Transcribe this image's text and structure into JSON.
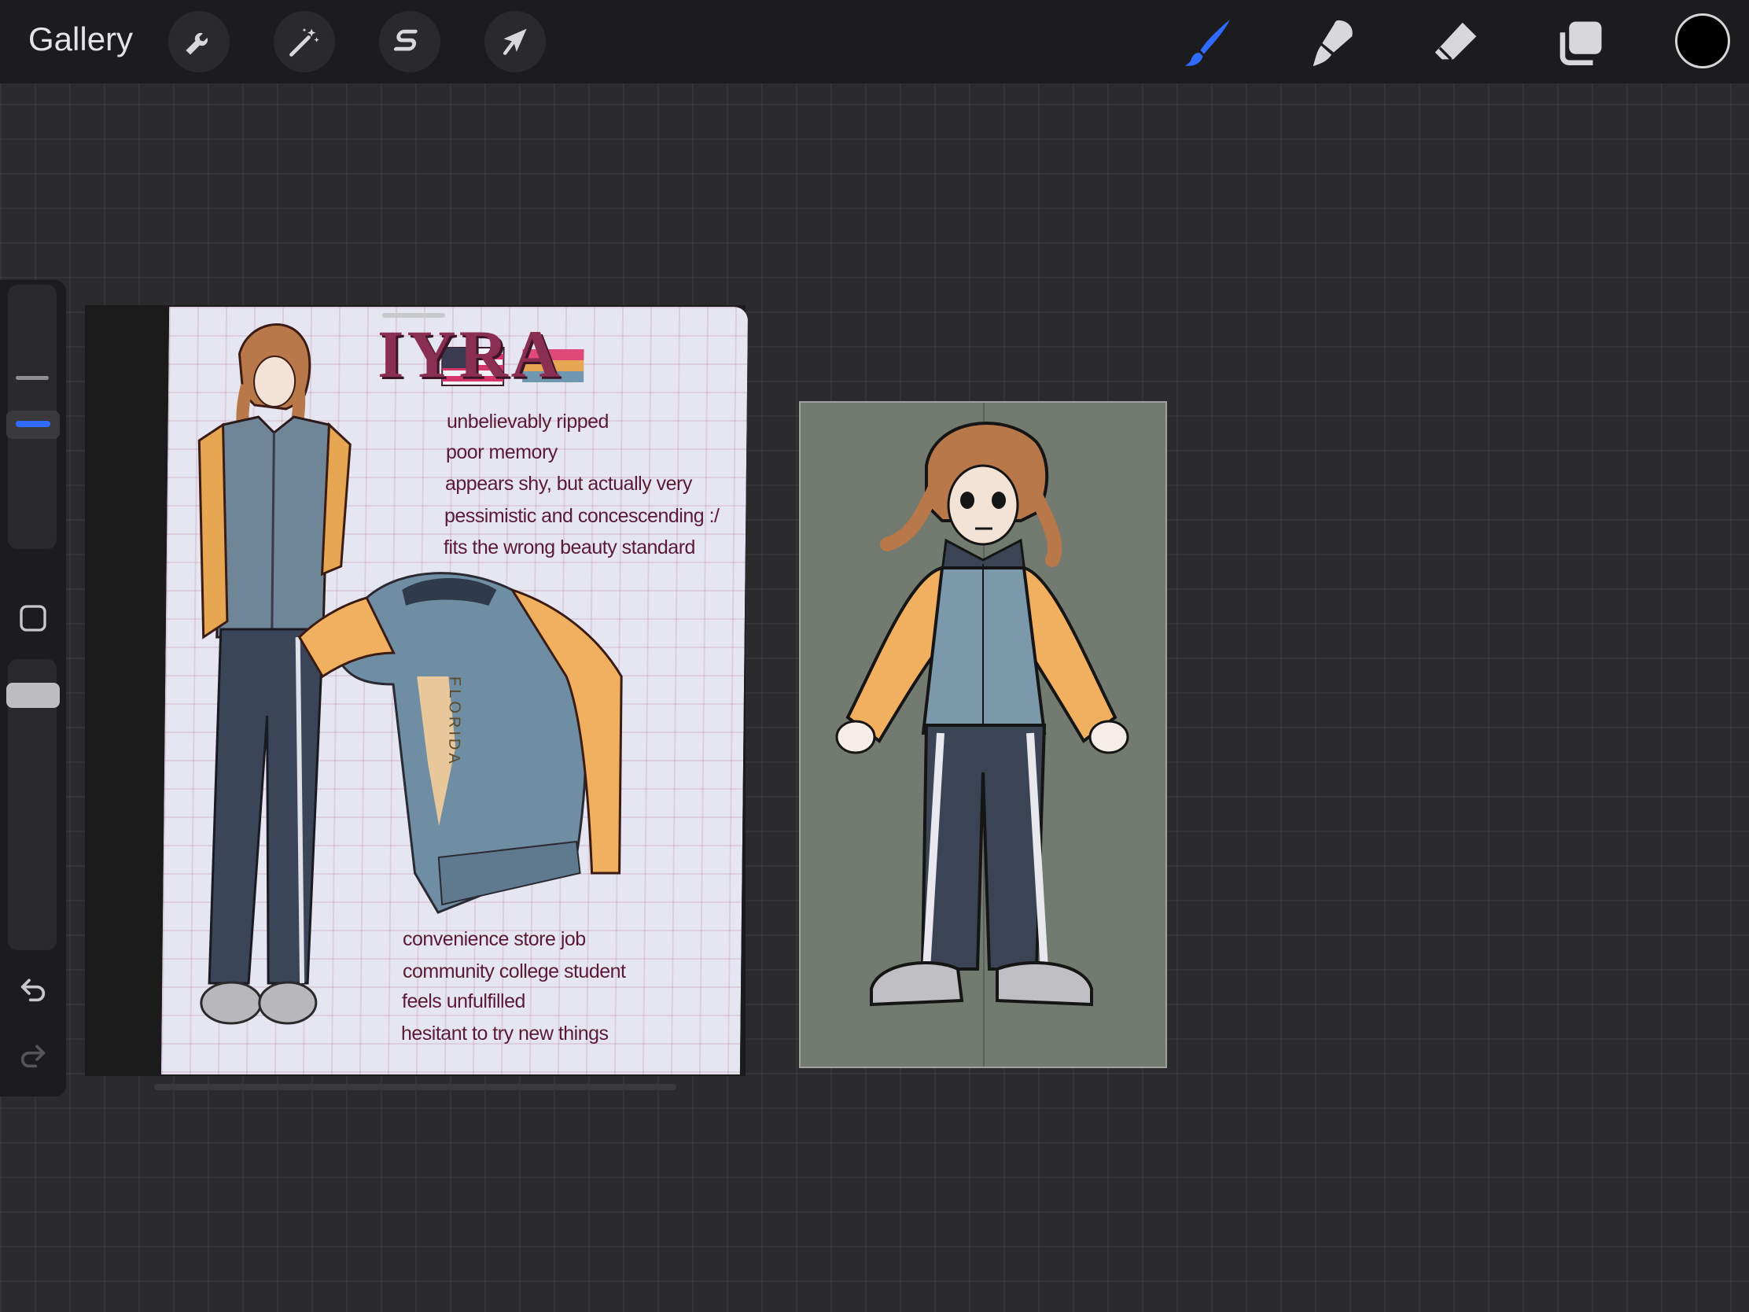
{
  "topbar": {
    "gallery_label": "Gallery",
    "left_tools": [
      {
        "name": "actions",
        "icon": "wrench-icon"
      },
      {
        "name": "adjustments",
        "icon": "magic-wand-icon"
      },
      {
        "name": "selection",
        "icon": "selection-s-icon"
      },
      {
        "name": "transform",
        "icon": "arrow-cursor-icon"
      }
    ],
    "right_tools": [
      {
        "name": "brush",
        "icon": "brush-icon",
        "active": true
      },
      {
        "name": "smudge",
        "icon": "smudge-icon"
      },
      {
        "name": "eraser",
        "icon": "eraser-icon"
      },
      {
        "name": "layers",
        "icon": "layers-icon"
      }
    ],
    "current_color": "#000000",
    "accent_color": "#2f6bff"
  },
  "sidebar": {
    "undo_icon": "undo-icon",
    "redo_icon": "redo-icon",
    "modify_icon": "square-icon"
  },
  "reference_card": {
    "name": "IYRA",
    "traits_top": [
      "unbelievably ripped",
      "poor memory",
      "appears shy, but actually very",
      "pessimistic and concescending :/",
      "fits the wrong beauty standard"
    ],
    "traits_bottom": [
      "convenience store job",
      "community college student",
      "feels unfulfilled",
      "hesitant to try new things"
    ],
    "jacket_print": "FLORIDA"
  }
}
